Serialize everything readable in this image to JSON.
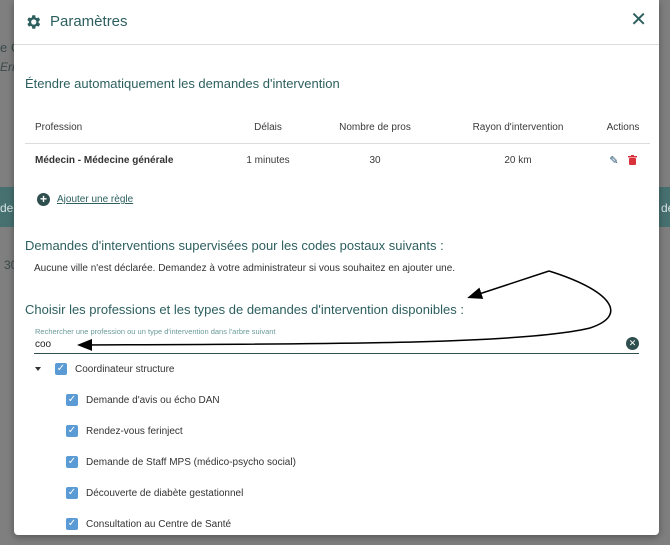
{
  "background": {
    "frag_1": "e Co",
    "frag_2": "Err",
    "frag_3": "de",
    "frag_4": "30",
    "frag_5": "de"
  },
  "dialog": {
    "title": "Paramètres",
    "close_label": "✕",
    "section1": {
      "title": "Étendre automatiquement les demandes d'intervention",
      "table": {
        "headers": [
          "Profession",
          "Délais",
          "Nombre de pros",
          "Rayon d'intervention",
          "Actions"
        ],
        "rows": [
          {
            "profession": "Médecin - Médecine générale",
            "delais": "1 minutes",
            "nombre": "30",
            "rayon": "20 km"
          }
        ]
      },
      "add_rule": "Ajouter une règle"
    },
    "section2": {
      "title": "Demandes d'interventions supervisées pour les codes postaux suivants :",
      "note": "Aucune ville n'est déclarée. Demandez à votre administrateur si vous souhaitez en ajouter une."
    },
    "section3": {
      "title": "Choisir les professions et les types de demandes d'intervention disponibles :",
      "search": {
        "label": "Rechercher une profession ou un type d'intervention dans l'arbre suivant",
        "value": "coo"
      },
      "tree": {
        "parent": "Coordinateur structure",
        "children": [
          "Demande d'avis ou écho DAN",
          "Rendez-vous ferinject",
          "Demande de Staff MPS (médico-psycho social)",
          "Découverte de diabète gestationnel",
          "Consultation au Centre de Santé"
        ]
      }
    }
  },
  "colors": {
    "accent": "#2d5f5f",
    "checkbox": "#5b9bd5",
    "delete": "#d9323a",
    "annotation_arrow": "#000000"
  },
  "icons": [
    "gear-icon",
    "close-icon",
    "pencil-icon",
    "trash-icon",
    "plus-circle-icon",
    "clear-icon",
    "caret-down-icon",
    "checkbox-checked-icon"
  ]
}
